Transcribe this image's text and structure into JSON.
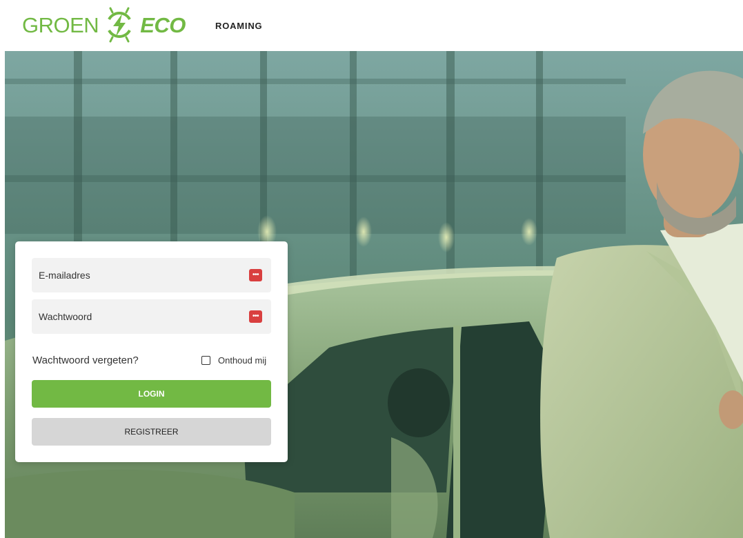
{
  "brand": {
    "logo_text_left": "GROEN",
    "logo_text_right": "ECO",
    "logo_icon": "bolt-circle-icon",
    "color": "#72b944"
  },
  "nav": {
    "roaming_label": "ROAMING"
  },
  "hero": {
    "image": "man-with-electric-car-photo",
    "overlay_color": "#5f9a6a"
  },
  "login_form": {
    "email": {
      "value": "",
      "placeholder": "E-mailadres",
      "icon": "password-manager-icon"
    },
    "password": {
      "value": "",
      "placeholder": "Wachtwoord",
      "icon": "password-manager-icon"
    },
    "forgot_password_label": "Wachtwoord vergeten?",
    "remember_me_label": "Onthoud mij",
    "remember_me_checked": false,
    "login_button_label": "LOGIN",
    "register_button_label": "REGISTREER",
    "login_color": "#72b944",
    "password_manager_color": "#d93f3f"
  }
}
